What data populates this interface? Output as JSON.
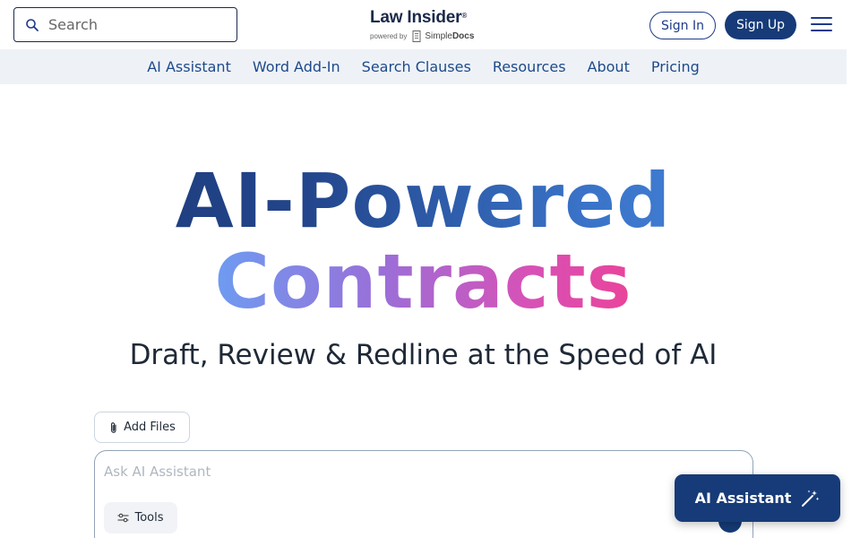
{
  "header": {
    "search_placeholder": "Search",
    "logo_title": "Law Insider",
    "logo_registered": "®",
    "logo_powered_by": "powered by",
    "logo_partner_simple": "Simple",
    "logo_partner_docs": "Docs",
    "sign_in_label": "Sign In",
    "sign_up_label": "Sign Up"
  },
  "nav": {
    "items": [
      {
        "label": "AI Assistant"
      },
      {
        "label": "Word Add-In"
      },
      {
        "label": "Search Clauses"
      },
      {
        "label": "Resources"
      },
      {
        "label": "About"
      },
      {
        "label": "Pricing"
      }
    ]
  },
  "hero": {
    "title_line1": "AI-Powered",
    "title_line2": "Contracts",
    "subtitle": "Draft, Review & Redline at the Speed of AI"
  },
  "composer": {
    "add_files_label": "Add Files",
    "input_placeholder": "Ask AI Assistant",
    "tools_label": "Tools"
  },
  "floating": {
    "ai_assistant_label": "AI Assistant"
  },
  "colors": {
    "brand_navy": "#163b78",
    "nav_background": "#eef2f7",
    "nav_text": "#1e4a8a",
    "gradient_pink": "#f23d8e"
  },
  "icons": {
    "search": "search-icon",
    "menu": "hamburger-menu-icon",
    "attach": "paperclip-icon",
    "tools": "sliders-icon",
    "sparkle": "magic-wand-icon"
  }
}
